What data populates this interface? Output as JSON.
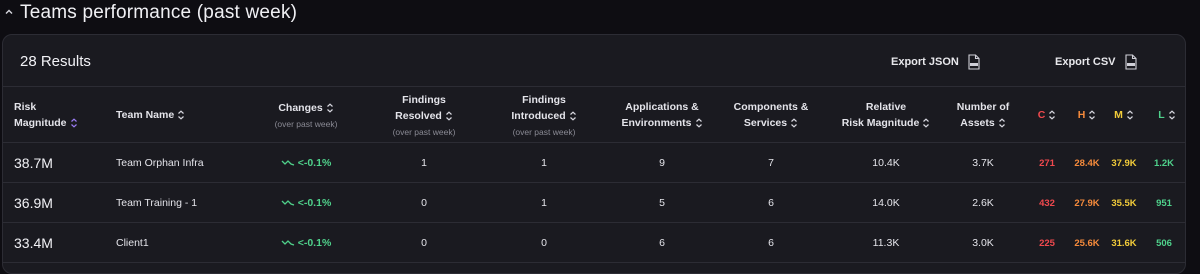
{
  "section": {
    "title": "Teams performance (past week)"
  },
  "toolbar": {
    "results_label": "28 Results",
    "export_json_label": "Export JSON",
    "export_csv_label": "Export CSV"
  },
  "colors": {
    "critical": "#f0494e",
    "high": "#f58a3b",
    "medium": "#f2cc3a",
    "low": "#4fd18b",
    "accent": "#9b7cf4"
  },
  "columns": {
    "risk_magnitude": {
      "line1": "Risk",
      "line2": "Magnitude"
    },
    "team_name": {
      "label": "Team Name"
    },
    "changes": {
      "label": "Changes",
      "sub": "(over past week)"
    },
    "findings_resolved": {
      "line1": "Findings",
      "line2": "Resolved",
      "sub": "(over past week)"
    },
    "findings_introduced": {
      "line1": "Findings",
      "line2": "Introduced",
      "sub": "(over past week)"
    },
    "apps_envs": {
      "line1": "Applications &",
      "line2": "Environments"
    },
    "components_services": {
      "line1": "Components &",
      "line2": "Services"
    },
    "relative_risk": {
      "line1": "Relative",
      "line2": "Risk Magnitude"
    },
    "num_assets": {
      "line1": "Number of",
      "line2": "Assets"
    },
    "critical": {
      "label": "C"
    },
    "high": {
      "label": "H"
    },
    "medium": {
      "label": "M"
    },
    "low": {
      "label": "L"
    }
  },
  "rows": [
    {
      "risk_magnitude": "38.7M",
      "team_name": "Team Orphan Infra",
      "change": "<-0.1%",
      "findings_resolved": "1",
      "findings_introduced": "1",
      "apps_envs": "9",
      "components_services": "7",
      "relative_risk": "10.4K",
      "num_assets": "3.7K",
      "critical": "271",
      "high": "28.4K",
      "medium": "37.9K",
      "low": "1.2K"
    },
    {
      "risk_magnitude": "36.9M",
      "team_name": "Team Training - 1",
      "change": "<-0.1%",
      "findings_resolved": "0",
      "findings_introduced": "1",
      "apps_envs": "5",
      "components_services": "6",
      "relative_risk": "14.0K",
      "num_assets": "2.6K",
      "critical": "432",
      "high": "27.9K",
      "medium": "35.5K",
      "low": "951"
    },
    {
      "risk_magnitude": "33.4M",
      "team_name": "Client1",
      "change": "<-0.1%",
      "findings_resolved": "0",
      "findings_introduced": "0",
      "apps_envs": "6",
      "components_services": "6",
      "relative_risk": "11.3K",
      "num_assets": "3.0K",
      "critical": "225",
      "high": "25.6K",
      "medium": "31.6K",
      "low": "506"
    }
  ]
}
